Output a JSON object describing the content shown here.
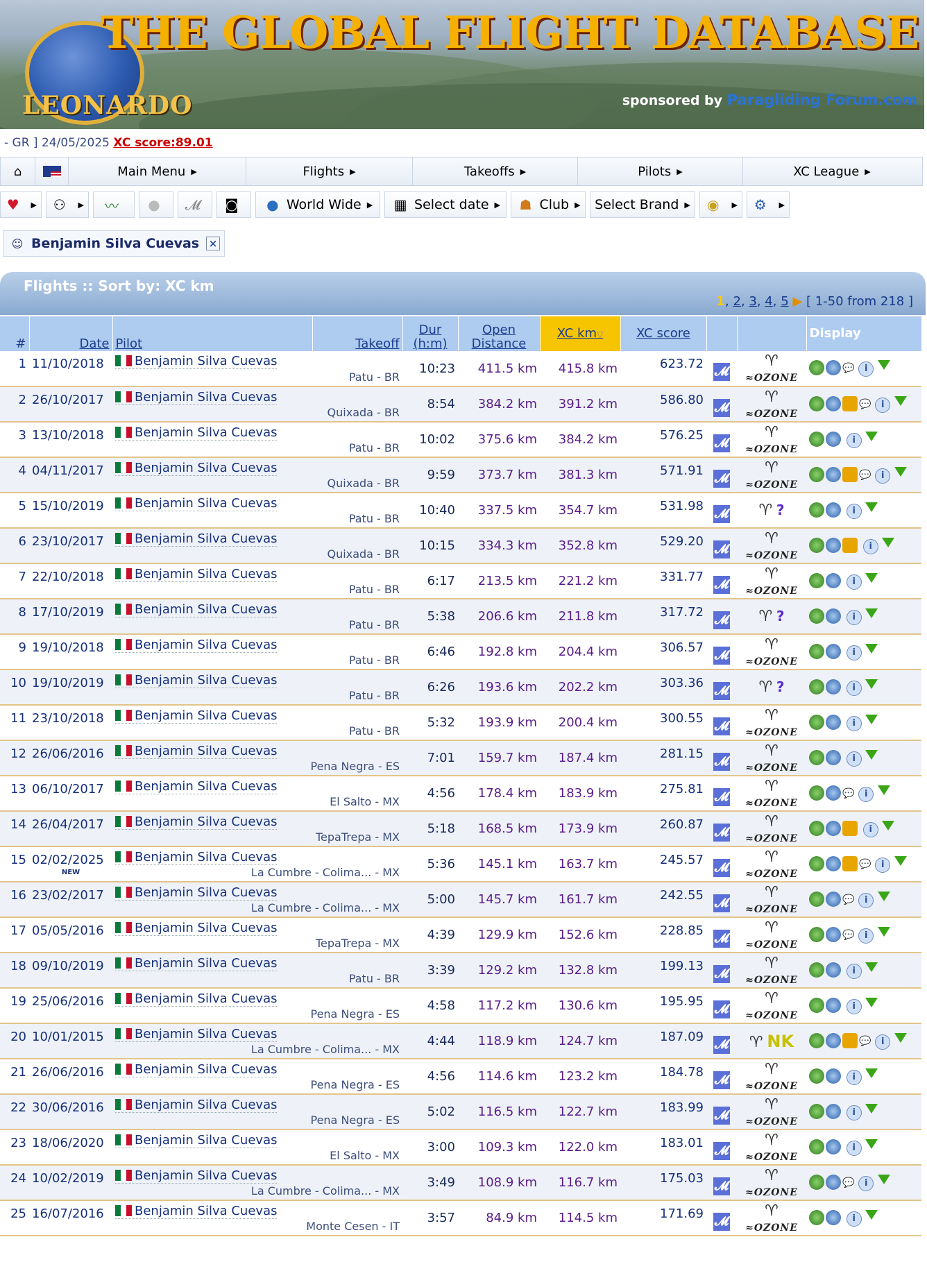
{
  "banner": {
    "logo_text": "LEONARDO",
    "title": "THE GLOBAL FLIGHT DATABASE",
    "sponsored_by": "sponsored by",
    "sponsor_brand": "Paragliding Forum.com"
  },
  "info": {
    "prefix": "- GR ] 24/05/2025",
    "score": "XC score:89.01"
  },
  "main_menu": {
    "items": [
      "Main Menu",
      "Flights",
      "Takeoffs",
      "Pilots",
      "XC League"
    ]
  },
  "toolbar": {
    "world_wide": "World Wide",
    "select_date": "Select date",
    "club": "Club",
    "select_brand": "Select Brand"
  },
  "filter": {
    "pilot": "Benjamin Silva Cuevas",
    "remove": "×"
  },
  "table_title": "Flights :: Sort by: XC km",
  "pager": {
    "current": "1",
    "pages": [
      "2",
      "3",
      "4",
      "5"
    ],
    "range": "[ 1-50 from 218 ]"
  },
  "columns": {
    "num": "#",
    "date": "Date",
    "pilot": "Pilot",
    "takeoff": "Takeoff",
    "dur_1": "Dur",
    "dur_2": "(h:m)",
    "open_1": "Open",
    "open_2": "Distance",
    "xc_km": "XC km",
    "xc_score": "XC score",
    "display": "Display"
  },
  "rows": [
    {
      "n": "1",
      "date": "11/10/2018",
      "pilot": "Benjamin Silva Cuevas",
      "takeoff": "Patu - BR",
      "dur": "10:23",
      "open": "411.5 km",
      "xc": "415.8 km",
      "score": "623.72",
      "brand": "ozone",
      "photo": false,
      "comment": true,
      "new": false
    },
    {
      "n": "2",
      "date": "26/10/2017",
      "pilot": "Benjamin Silva Cuevas",
      "takeoff": "Quixada - BR",
      "dur": "8:54",
      "open": "384.2 km",
      "xc": "391.2 km",
      "score": "586.80",
      "brand": "ozone",
      "photo": true,
      "comment": true,
      "new": false
    },
    {
      "n": "3",
      "date": "13/10/2018",
      "pilot": "Benjamin Silva Cuevas",
      "takeoff": "Patu - BR",
      "dur": "10:02",
      "open": "375.6 km",
      "xc": "384.2 km",
      "score": "576.25",
      "brand": "ozone",
      "photo": false,
      "comment": false,
      "new": false
    },
    {
      "n": "4",
      "date": "04/11/2017",
      "pilot": "Benjamin Silva Cuevas",
      "takeoff": "Quixada - BR",
      "dur": "9:59",
      "open": "373.7 km",
      "xc": "381.3 km",
      "score": "571.91",
      "brand": "ozone",
      "photo": true,
      "comment": true,
      "new": false
    },
    {
      "n": "5",
      "date": "15/10/2019",
      "pilot": "Benjamin Silva Cuevas",
      "takeoff": "Patu - BR",
      "dur": "10:40",
      "open": "337.5 km",
      "xc": "354.7 km",
      "score": "531.98",
      "brand": "unknown",
      "photo": false,
      "comment": false,
      "new": false
    },
    {
      "n": "6",
      "date": "23/10/2017",
      "pilot": "Benjamin Silva Cuevas",
      "takeoff": "Quixada - BR",
      "dur": "10:15",
      "open": "334.3 km",
      "xc": "352.8 km",
      "score": "529.20",
      "brand": "ozone",
      "photo": true,
      "comment": false,
      "new": false
    },
    {
      "n": "7",
      "date": "22/10/2018",
      "pilot": "Benjamin Silva Cuevas",
      "takeoff": "Patu - BR",
      "dur": "6:17",
      "open": "213.5 km",
      "xc": "221.2 km",
      "score": "331.77",
      "brand": "ozone",
      "photo": false,
      "comment": false,
      "new": false
    },
    {
      "n": "8",
      "date": "17/10/2019",
      "pilot": "Benjamin Silva Cuevas",
      "takeoff": "Patu - BR",
      "dur": "5:38",
      "open": "206.6 km",
      "xc": "211.8 km",
      "score": "317.72",
      "brand": "unknown",
      "photo": false,
      "comment": false,
      "new": false
    },
    {
      "n": "9",
      "date": "19/10/2018",
      "pilot": "Benjamin Silva Cuevas",
      "takeoff": "Patu - BR",
      "dur": "6:46",
      "open": "192.8 km",
      "xc": "204.4 km",
      "score": "306.57",
      "brand": "ozone",
      "photo": false,
      "comment": false,
      "new": false
    },
    {
      "n": "10",
      "date": "19/10/2019",
      "pilot": "Benjamin Silva Cuevas",
      "takeoff": "Patu - BR",
      "dur": "6:26",
      "open": "193.6 km",
      "xc": "202.2 km",
      "score": "303.36",
      "brand": "unknown",
      "photo": false,
      "comment": false,
      "new": false
    },
    {
      "n": "11",
      "date": "23/10/2018",
      "pilot": "Benjamin Silva Cuevas",
      "takeoff": "Patu - BR",
      "dur": "5:32",
      "open": "193.9 km",
      "xc": "200.4 km",
      "score": "300.55",
      "brand": "ozone",
      "photo": false,
      "comment": false,
      "new": false
    },
    {
      "n": "12",
      "date": "26/06/2016",
      "pilot": "Benjamin Silva Cuevas",
      "takeoff": "Pena Negra - ES",
      "dur": "7:01",
      "open": "159.7 km",
      "xc": "187.4 km",
      "score": "281.15",
      "brand": "ozone",
      "photo": false,
      "comment": false,
      "new": false
    },
    {
      "n": "13",
      "date": "06/10/2017",
      "pilot": "Benjamin Silva Cuevas",
      "takeoff": "El Salto - MX",
      "dur": "4:56",
      "open": "178.4 km",
      "xc": "183.9 km",
      "score": "275.81",
      "brand": "ozone",
      "photo": false,
      "comment": true,
      "new": false
    },
    {
      "n": "14",
      "date": "26/04/2017",
      "pilot": "Benjamin Silva Cuevas",
      "takeoff": "TepaTrepa - MX",
      "dur": "5:18",
      "open": "168.5 km",
      "xc": "173.9 km",
      "score": "260.87",
      "brand": "ozone",
      "photo": true,
      "comment": false,
      "new": false
    },
    {
      "n": "15",
      "date": "02/02/2025",
      "pilot": "Benjamin Silva Cuevas",
      "takeoff": "La Cumbre - Colima... - MX",
      "dur": "5:36",
      "open": "145.1 km",
      "xc": "163.7 km",
      "score": "245.57",
      "brand": "ozone",
      "photo": true,
      "comment": true,
      "new": true,
      "new_label": "NEW"
    },
    {
      "n": "16",
      "date": "23/02/2017",
      "pilot": "Benjamin Silva Cuevas",
      "takeoff": "La Cumbre - Colima... - MX",
      "dur": "5:00",
      "open": "145.7 km",
      "xc": "161.7 km",
      "score": "242.55",
      "brand": "ozone",
      "photo": false,
      "comment": true,
      "new": false
    },
    {
      "n": "17",
      "date": "05/05/2016",
      "pilot": "Benjamin Silva Cuevas",
      "takeoff": "TepaTrepa - MX",
      "dur": "4:39",
      "open": "129.9 km",
      "xc": "152.6 km",
      "score": "228.85",
      "brand": "ozone",
      "photo": false,
      "comment": true,
      "new": false
    },
    {
      "n": "18",
      "date": "09/10/2019",
      "pilot": "Benjamin Silva Cuevas",
      "takeoff": "Patu - BR",
      "dur": "3:39",
      "open": "129.2 km",
      "xc": "132.8 km",
      "score": "199.13",
      "brand": "ozone",
      "photo": false,
      "comment": false,
      "new": false
    },
    {
      "n": "19",
      "date": "25/06/2016",
      "pilot": "Benjamin Silva Cuevas",
      "takeoff": "Pena Negra - ES",
      "dur": "4:58",
      "open": "117.2 km",
      "xc": "130.6 km",
      "score": "195.95",
      "brand": "ozone",
      "photo": false,
      "comment": false,
      "new": false
    },
    {
      "n": "20",
      "date": "10/01/2015",
      "pilot": "Benjamin Silva Cuevas",
      "takeoff": "La Cumbre - Colima... - MX",
      "dur": "4:44",
      "open": "118.9 km",
      "xc": "124.7 km",
      "score": "187.09",
      "brand": "nk",
      "photo": true,
      "comment": true,
      "new": false
    },
    {
      "n": "21",
      "date": "26/06/2016",
      "pilot": "Benjamin Silva Cuevas",
      "takeoff": "Pena Negra - ES",
      "dur": "4:56",
      "open": "114.6 km",
      "xc": "123.2 km",
      "score": "184.78",
      "brand": "ozone",
      "photo": false,
      "comment": false,
      "new": false
    },
    {
      "n": "22",
      "date": "30/06/2016",
      "pilot": "Benjamin Silva Cuevas",
      "takeoff": "Pena Negra - ES",
      "dur": "5:02",
      "open": "116.5 km",
      "xc": "122.7 km",
      "score": "183.99",
      "brand": "ozone",
      "photo": false,
      "comment": false,
      "new": false
    },
    {
      "n": "23",
      "date": "18/06/2020",
      "pilot": "Benjamin Silva Cuevas",
      "takeoff": "El Salto - MX",
      "dur": "3:00",
      "open": "109.3 km",
      "xc": "122.0 km",
      "score": "183.01",
      "brand": "ozone",
      "photo": false,
      "comment": false,
      "new": false
    },
    {
      "n": "24",
      "date": "10/02/2019",
      "pilot": "Benjamin Silva Cuevas",
      "takeoff": "La Cumbre - Colima... - MX",
      "dur": "3:49",
      "open": "108.9 km",
      "xc": "116.7 km",
      "score": "175.03",
      "brand": "ozone",
      "photo": false,
      "comment": true,
      "new": false
    },
    {
      "n": "25",
      "date": "16/07/2016",
      "pilot": "Benjamin Silva Cuevas",
      "takeoff": "Monte Cesen - IT",
      "dur": "3:57",
      "open": "84.9 km",
      "xc": "114.5 km",
      "score": "171.69",
      "brand": "ozone",
      "photo": false,
      "comment": false,
      "new": false
    }
  ]
}
